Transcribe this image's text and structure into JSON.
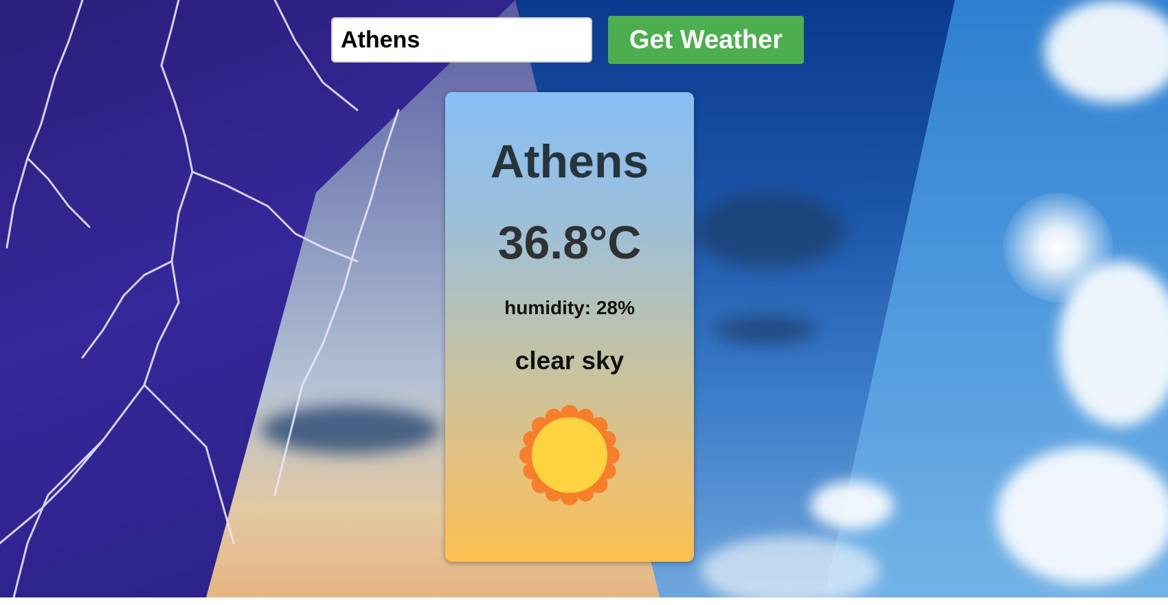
{
  "search": {
    "input_value": "Athens",
    "button_label": "Get Weather"
  },
  "weather": {
    "city": "Athens",
    "temperature": "36.8°C",
    "humidity": "humidity: 28%",
    "description": "clear sky",
    "icon": "sun-icon"
  },
  "colors": {
    "button": "#4cae4f",
    "card_top": "#87bff5",
    "card_bottom": "#fbc04e",
    "sun_outer": "#f77f2c",
    "sun_inner": "#fdd43f"
  }
}
